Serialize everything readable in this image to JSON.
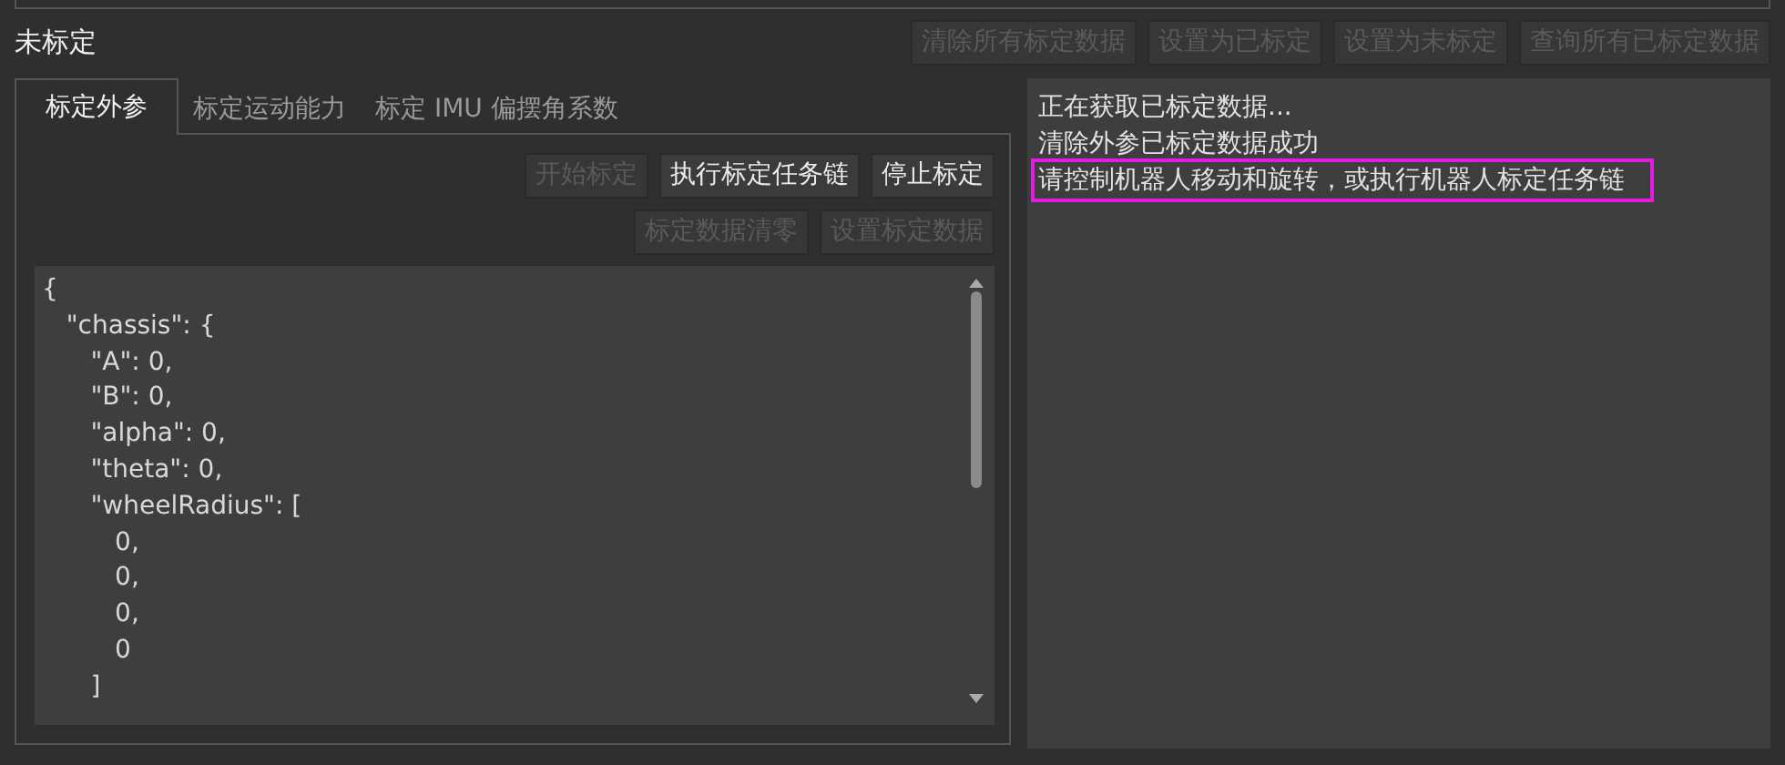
{
  "status": "未标定",
  "top_buttons": [
    {
      "label": "清除所有标定数据",
      "disabled": true
    },
    {
      "label": "设置为已标定",
      "disabled": true
    },
    {
      "label": "设置为未标定",
      "disabled": true
    },
    {
      "label": "查询所有已标定数据",
      "disabled": true
    }
  ],
  "tabs": [
    {
      "label": "标定外参",
      "selected": true
    },
    {
      "label": "标定运动能力",
      "selected": false
    },
    {
      "label": "标定 IMU 偏摆角系数",
      "selected": false
    }
  ],
  "action_rows": [
    [
      {
        "label": "开始标定",
        "disabled": true
      },
      {
        "label": "执行标定任务链",
        "disabled": false
      },
      {
        "label": "停止标定",
        "disabled": false
      }
    ],
    [
      {
        "label": "标定数据清零",
        "disabled": true
      },
      {
        "label": "设置标定数据",
        "disabled": true
      }
    ]
  ],
  "editor_lines": [
    "{",
    "   \"chassis\": {",
    "      \"A\": 0,",
    "      \"B\": 0,",
    "      \"alpha\": 0,",
    "      \"theta\": 0,",
    "      \"wheelRadius\": [",
    "         0,",
    "         0,",
    "         0,",
    "         0",
    "      ]"
  ],
  "log": [
    {
      "text": "正在获取已标定数据...",
      "highlighted": false
    },
    {
      "text": "清除外参已标定数据成功",
      "highlighted": false
    },
    {
      "text": "请控制机器人移动和旋转，或执行机器人标定任务链",
      "highlighted": true
    }
  ]
}
